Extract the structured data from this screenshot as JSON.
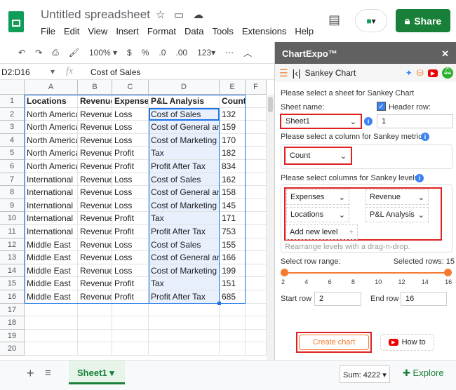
{
  "header": {
    "title": "Untitled spreadsheet",
    "menu": [
      "File",
      "Edit",
      "View",
      "Insert",
      "Format",
      "Data",
      "Tools",
      "Extensions",
      "Help"
    ],
    "share_label": "Share"
  },
  "toolbar": {
    "zoom": "100%",
    "currency": "$",
    "percent": "%",
    "dec_less": ".0",
    "dec_more": ".00",
    "format": "123"
  },
  "formula": {
    "range": "D2:D16",
    "fx": "fx",
    "value": "Cost of Sales"
  },
  "columns": [
    "A",
    "B",
    "C",
    "D",
    "E",
    "F"
  ],
  "rows": [
    [
      "Locations",
      "Revenue",
      "Expenses",
      "P&L Analysis",
      "Count"
    ],
    [
      "North America",
      "Revenue",
      "Loss",
      "Cost of Sales",
      "132"
    ],
    [
      "North America",
      "Revenue",
      "Loss",
      "Cost of General and A",
      "159"
    ],
    [
      "North America",
      "Revenue",
      "Loss",
      "Cost of Marketing",
      "170"
    ],
    [
      "North America",
      "Revenue",
      "Profit",
      "Tax",
      "182"
    ],
    [
      "North America",
      "Revenue",
      "Profit",
      "Profit After Tax",
      "834"
    ],
    [
      "International",
      "Revenue",
      "Loss",
      "Cost of Sales",
      "162"
    ],
    [
      "International",
      "Revenue",
      "Loss",
      "Cost of General and A",
      "158"
    ],
    [
      "International",
      "Revenue",
      "Loss",
      "Cost of Marketing",
      "145"
    ],
    [
      "International",
      "Revenue",
      "Profit",
      "Tax",
      "171"
    ],
    [
      "International",
      "Revenue",
      "Profit",
      "Profit After Tax",
      "753"
    ],
    [
      "Middle East",
      "Revenue",
      "Loss",
      "Cost of Sales",
      "155"
    ],
    [
      "Middle East",
      "Revenue",
      "Loss",
      "Cost of General and A",
      "166"
    ],
    [
      "Middle East",
      "Revenue",
      "Loss",
      "Cost of Marketing",
      "199"
    ],
    [
      "Middle East",
      "Revenue",
      "Profit",
      "Tax",
      "151"
    ],
    [
      "Middle East",
      "Revenue",
      "Profit",
      "Profit After Tax",
      "685"
    ]
  ],
  "row_numbers": [
    "1",
    "2",
    "3",
    "4",
    "5",
    "6",
    "7",
    "8",
    "9",
    "10",
    "11",
    "12",
    "13",
    "14",
    "15",
    "16",
    "17",
    "18",
    "19",
    "20"
  ],
  "bottom": {
    "add": "+",
    "sheet_tab": "Sheet1",
    "sum": "Sum: 4222",
    "explore": "Explore"
  },
  "sidebar": {
    "title": "ChartExpo™",
    "close": "✕",
    "chart_name": "Sankey Chart",
    "select_sheet": "Please select a sheet for Sankey Chart",
    "sheet_name_label": "Sheet name:",
    "sheet_value": "Sheet1",
    "header_row_label": "Header row:",
    "header_row_value": "1",
    "header_checked": true,
    "metric_label": "Please select a column for Sankey metric:",
    "metric_value": "Count",
    "levels_label": "Please select columns for Sankey levels:",
    "levels": [
      "Expenses",
      "Revenue",
      "Locations",
      "P&L Analysis"
    ],
    "add_level": "Add new level",
    "rearrange": "Rearrange levels with a drag-n-drop.",
    "range_label": "Select row range:",
    "selected_rows": "Selected rows: 15",
    "range_ticks": [
      "2",
      "4",
      "6",
      "8",
      "10",
      "12",
      "14",
      "16"
    ],
    "range_min": 2,
    "range_max": 16,
    "start_label": "Start row",
    "start_value": "2",
    "end_label": "End row",
    "end_value": "16",
    "create": "Create chart",
    "howto": "How to"
  },
  "colors": {
    "accent": "#f47b30",
    "share": "#188038",
    "sidebar_header": "#616161",
    "selection": "#e8f0fe"
  }
}
